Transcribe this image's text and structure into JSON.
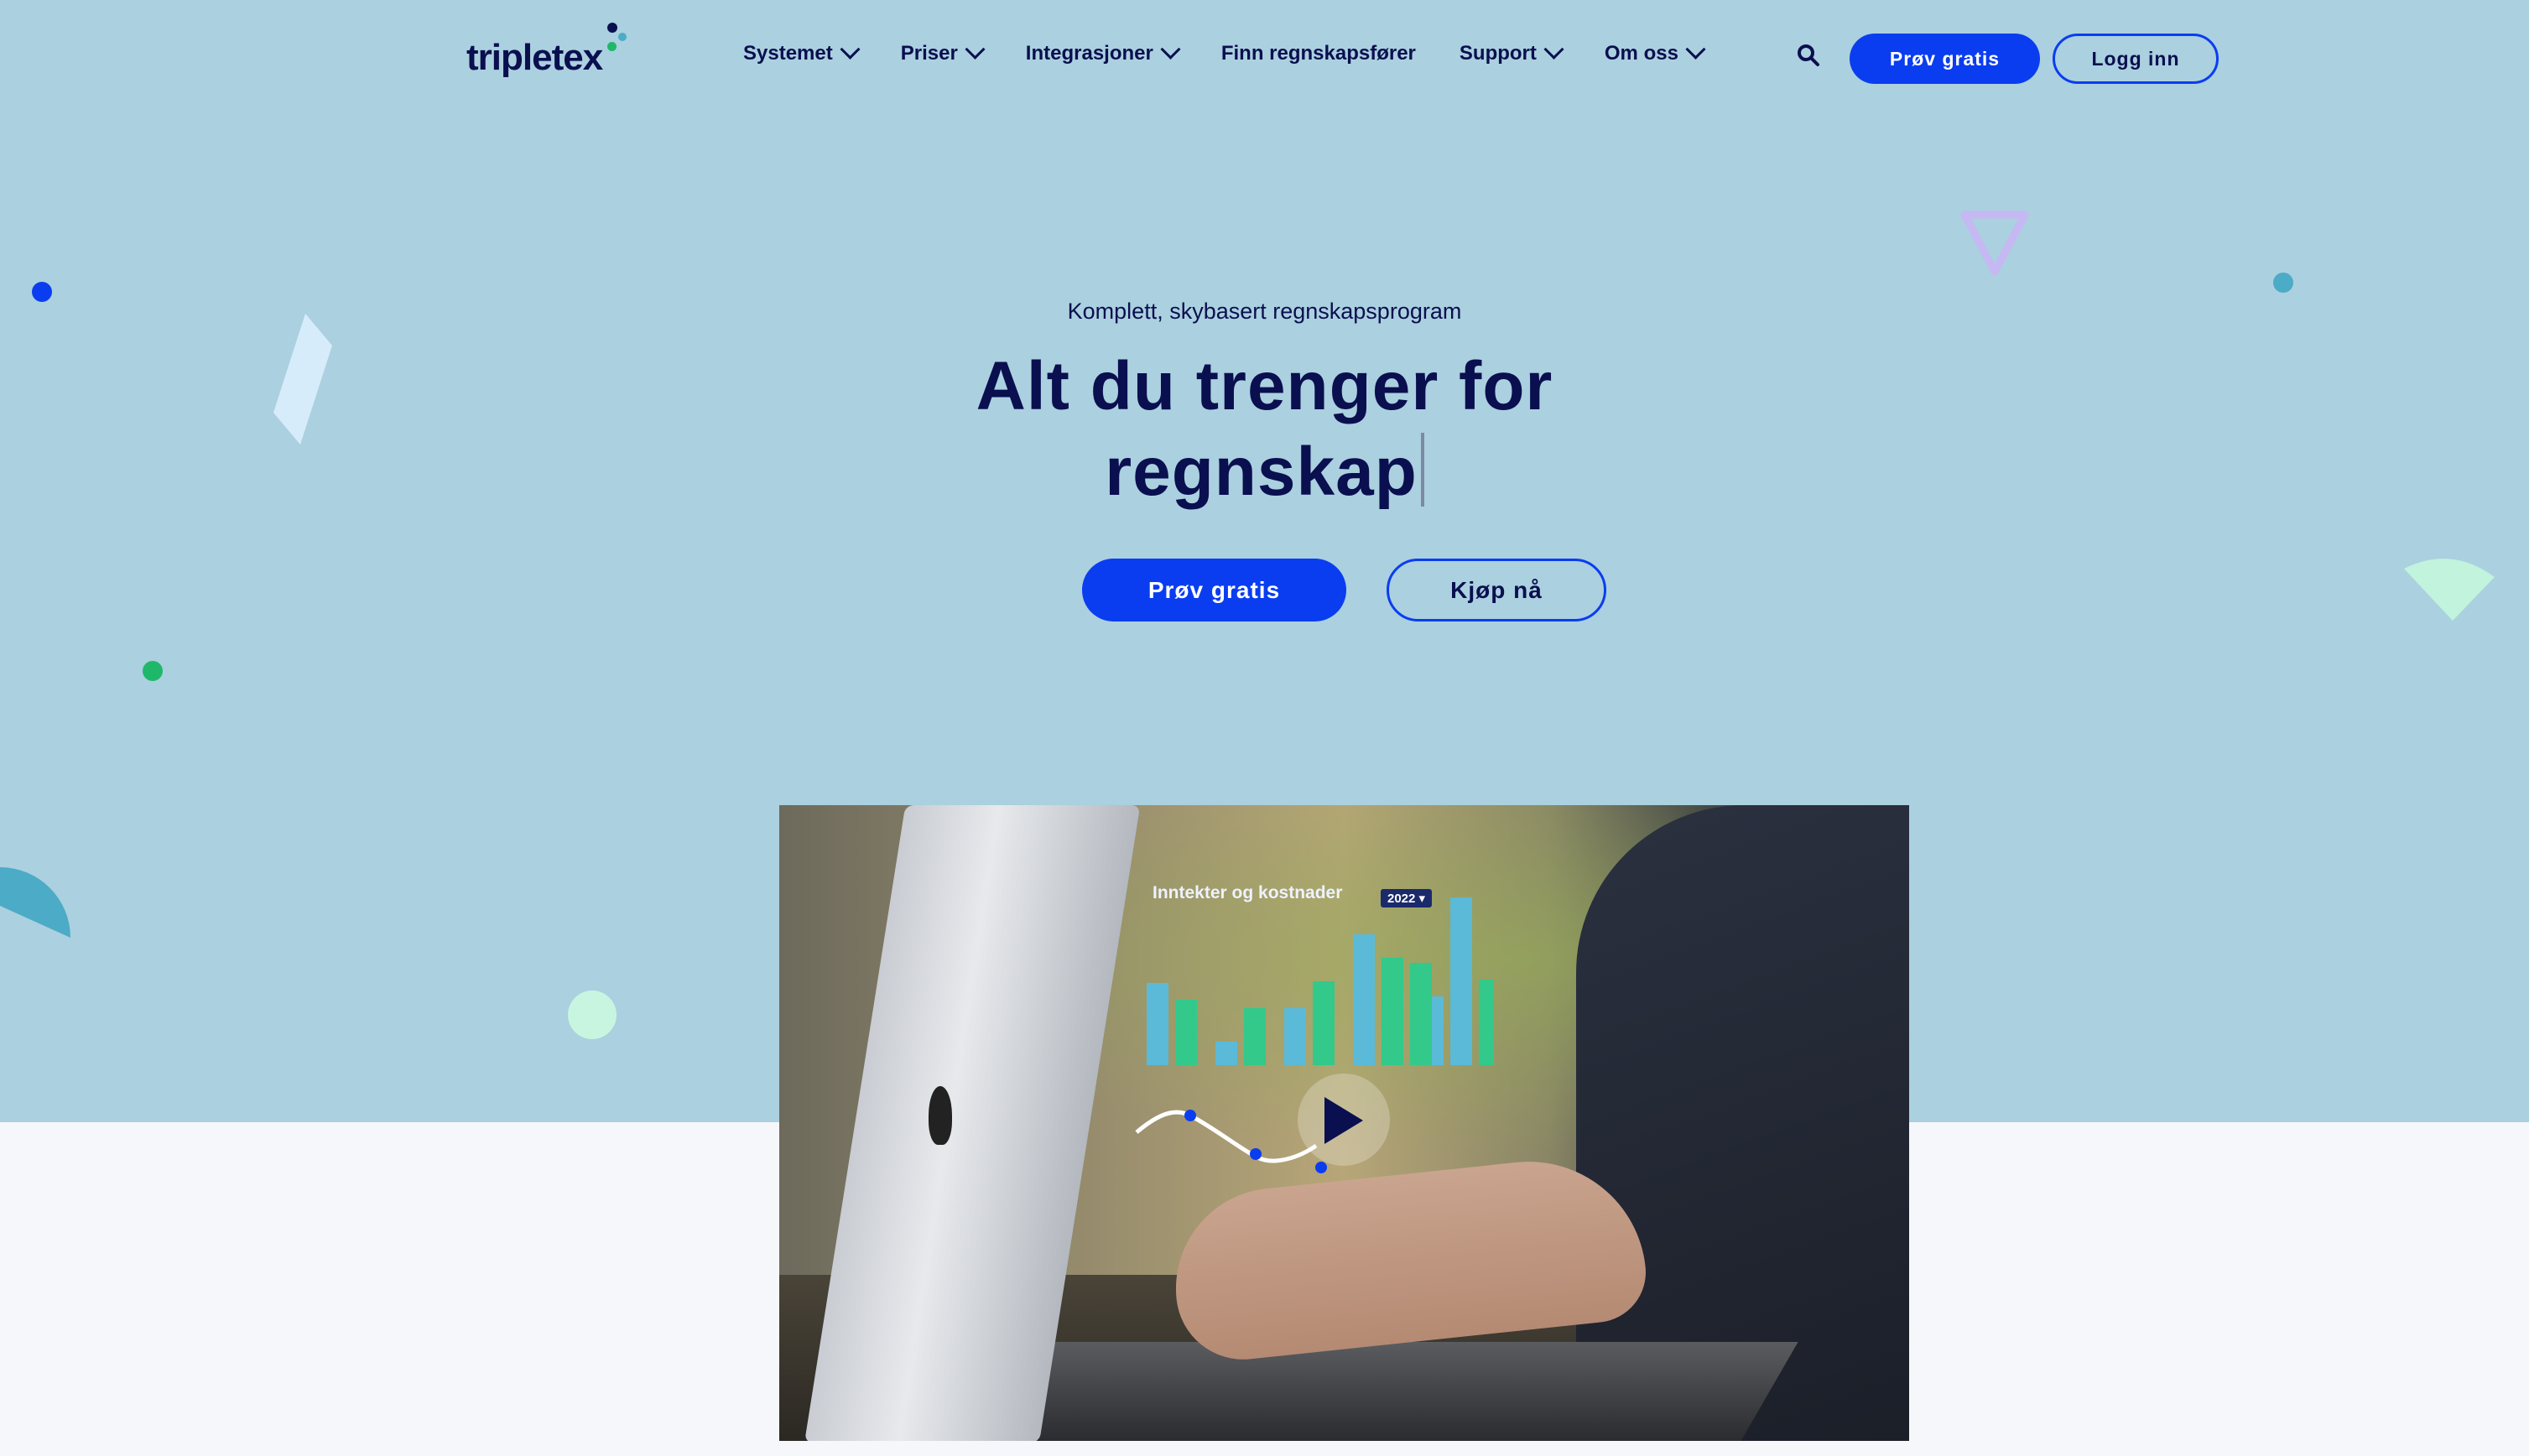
{
  "nav": {
    "logo": "tripletex",
    "items": [
      {
        "label": "Systemet",
        "dropdown": true
      },
      {
        "label": "Priser",
        "dropdown": true
      },
      {
        "label": "Integrasjoner",
        "dropdown": true
      },
      {
        "label": "Finn regnskapsfører",
        "dropdown": false
      },
      {
        "label": "Support",
        "dropdown": true
      },
      {
        "label": "Om oss",
        "dropdown": true
      }
    ],
    "search_icon": "search-icon",
    "trial_label": "Prøv gratis",
    "login_label": "Logg inn"
  },
  "hero": {
    "eyebrow": "Komplett, skybasert regnskapsprogram",
    "headline_line1": "Alt du trenger for",
    "headline_line2": "regnskap",
    "primary_cta": "Prøv gratis",
    "secondary_cta": "Kjøp nå"
  },
  "video": {
    "overlay_title": "Inntekter og kostnader",
    "year": "2022",
    "play_icon": "play-icon"
  },
  "colors": {
    "hero_bg": "#abd0df",
    "page_bg": "#f6f7fb",
    "primary": "#0a3df0",
    "text": "#0a0f4f",
    "bar_blue": "#5bbad8",
    "bar_green": "#33c98a"
  }
}
